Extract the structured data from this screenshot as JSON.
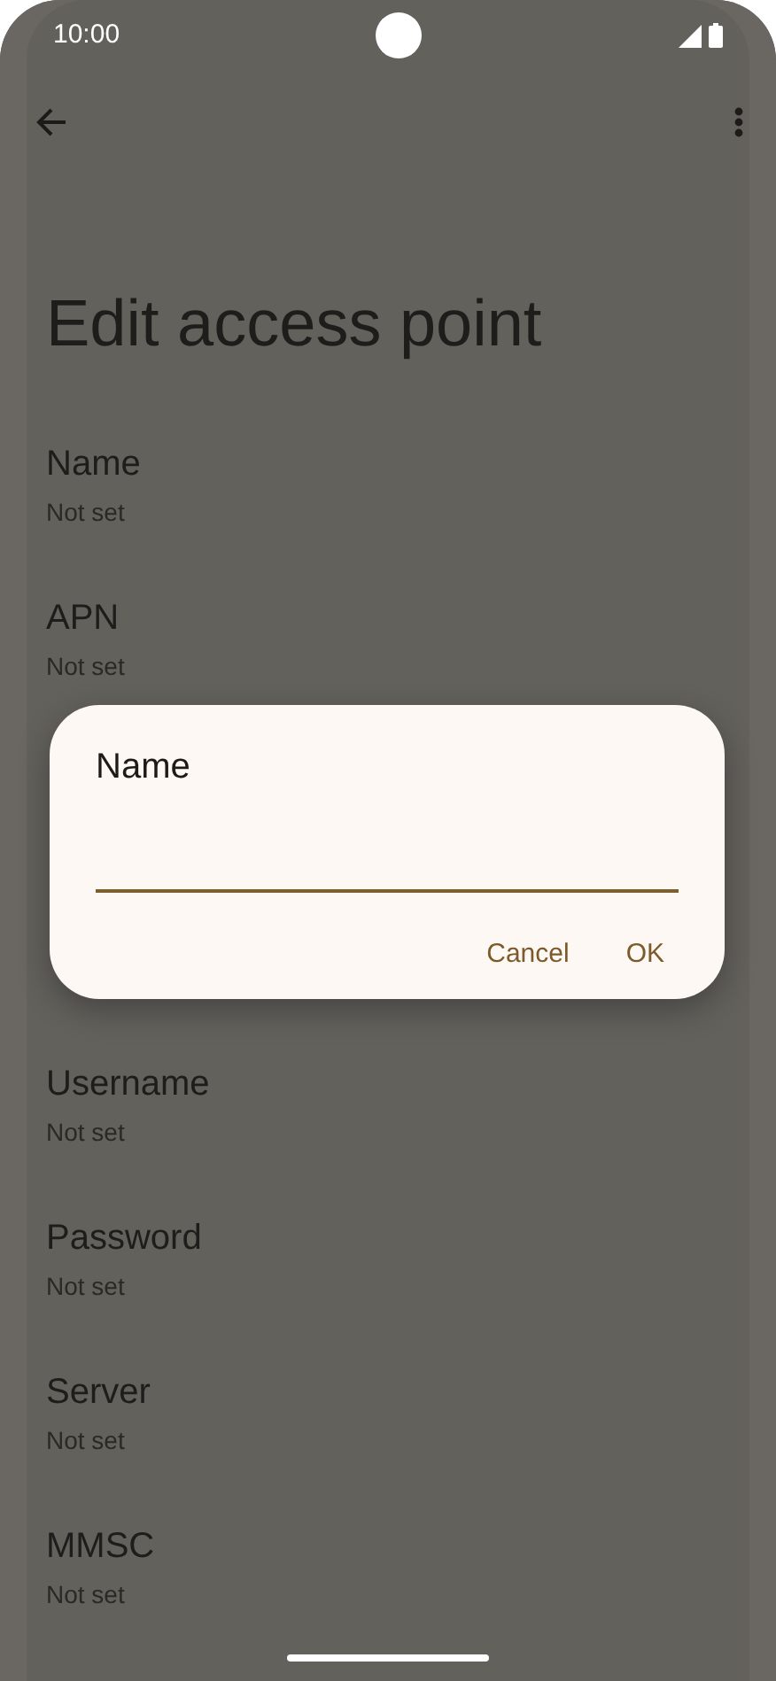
{
  "status_bar": {
    "time": "10:00"
  },
  "title": "Edit access point",
  "items_above": [
    {
      "title": "Name",
      "summary": "Not set"
    },
    {
      "title": "APN",
      "summary": "Not set"
    }
  ],
  "items_below": [
    {
      "title": "Username",
      "summary": "Not set"
    },
    {
      "title": "Password",
      "summary": "Not set"
    },
    {
      "title": "Server",
      "summary": "Not set"
    },
    {
      "title": "MMSC",
      "summary": "Not set"
    }
  ],
  "dialog": {
    "title": "Name",
    "buttons": [
      "Cancel",
      "OK"
    ]
  }
}
